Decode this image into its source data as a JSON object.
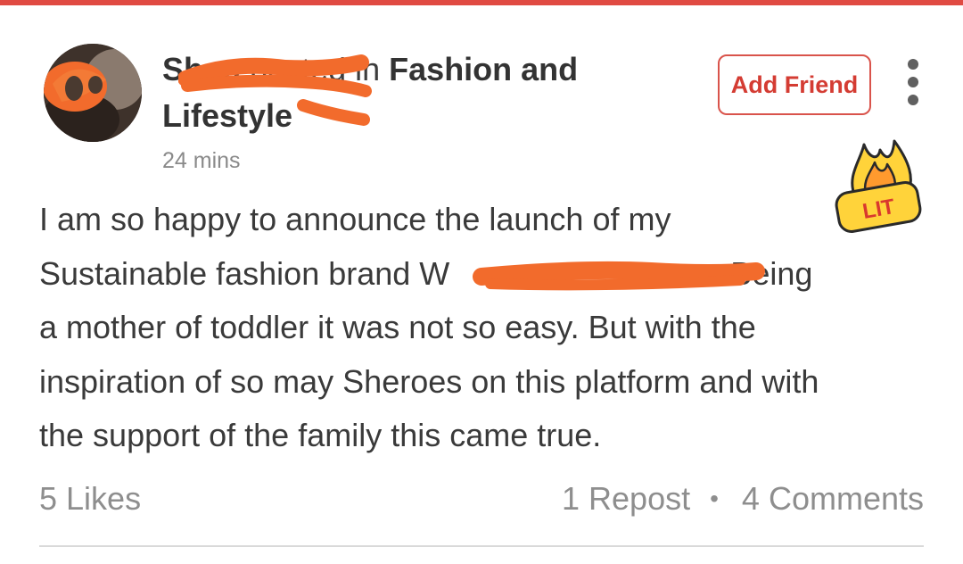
{
  "post": {
    "author_visible": "Sh m",
    "posted_in_label": "posted in",
    "community": "Fashion and Lifestyle",
    "time": "24 mins",
    "add_friend_label": "Add Friend",
    "badge_text": "LIT",
    "body_lines": [
      "I am so happy to announce the launch of my",
      "Sustainable fashion brand W",
      ". Being",
      "a mother of toddler it was not so easy. But with the",
      "inspiration of so may Sheroes on this platform and with",
      "the support of the family this came true."
    ]
  },
  "stats": {
    "likes": "5 Likes",
    "reposts": "1 Repost",
    "separator": "•",
    "comments": "4 Comments"
  },
  "colors": {
    "accent": "#e04a42",
    "redaction": "#f26b2c",
    "muted_text": "#8a8a8a"
  }
}
